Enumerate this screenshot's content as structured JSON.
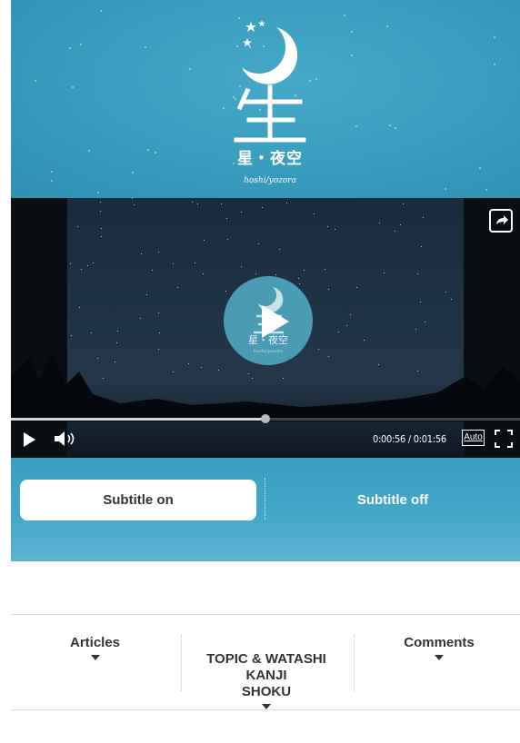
{
  "logo": {
    "title": "星・夜空",
    "romaji": "hoshi/yozora"
  },
  "video": {
    "progress_fraction": 0.5,
    "time_display": "0:00:56 / 0:01:56",
    "quality_label": "Auto",
    "icons": [
      "share-icon",
      "play-icon",
      "volume-icon",
      "fullscreen-icon"
    ]
  },
  "subtitles": {
    "on_label": "Subtitle on",
    "off_label": "Subtitle off"
  },
  "tabs": [
    {
      "label": "Articles"
    },
    {
      "label": "TOPIC & WATASHI\nKANJI\nSHOKU"
    },
    {
      "label": "Comments"
    }
  ],
  "colors": {
    "brand_blue": "#3b9fbf",
    "white": "#ffffff",
    "text_dark": "#333333"
  }
}
